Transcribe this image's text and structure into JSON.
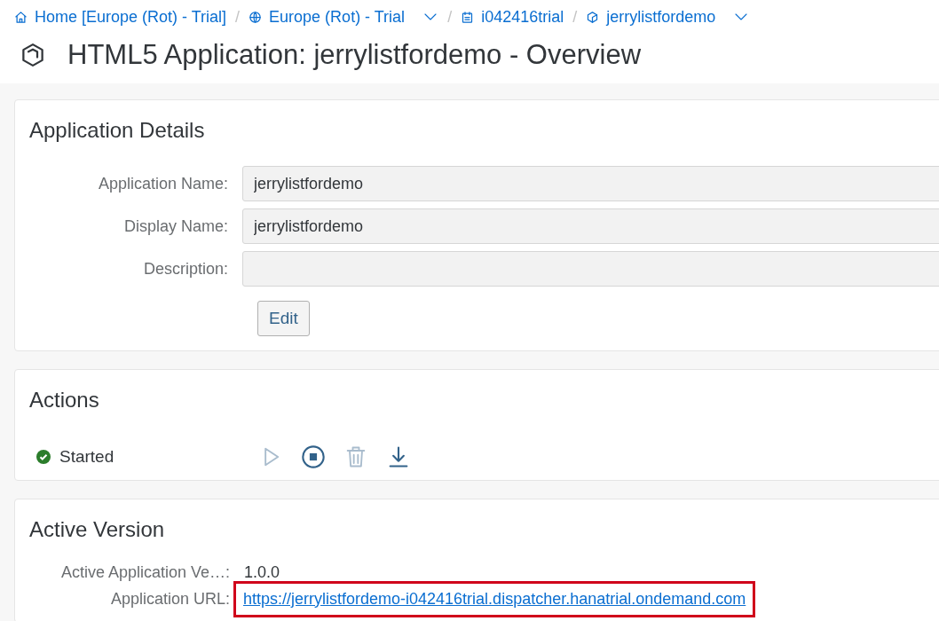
{
  "breadcrumb": [
    {
      "kind": "home",
      "label": "Home [Europe (Rot) - Trial]",
      "dropdown": false
    },
    {
      "kind": "globe",
      "label": "Europe (Rot) - Trial",
      "dropdown": true,
      "separator": "/"
    },
    {
      "kind": "account",
      "label": "i042416trial",
      "dropdown": false,
      "separator": "/"
    },
    {
      "kind": "app",
      "label": "jerrylistfordemo",
      "dropdown": true,
      "separator": "/"
    }
  ],
  "title": "HTML5 Application: jerrylistfordemo - Overview",
  "details": {
    "title": "Application Details",
    "fields": [
      {
        "label": "Application Name:",
        "value": "jerrylistfordemo"
      },
      {
        "label": "Display Name:",
        "value": "jerrylistfordemo"
      },
      {
        "label": "Description:"
      }
    ],
    "edit_button": "Edit"
  },
  "actions": {
    "title": "Actions",
    "status": {
      "label": "Started",
      "kind": "success"
    },
    "buttons": [
      {
        "kind": "start",
        "disabled": true
      },
      {
        "kind": "stop",
        "disabled": false
      },
      {
        "kind": "delete",
        "disabled": true
      },
      {
        "kind": "download",
        "disabled": false
      }
    ]
  },
  "active_version": {
    "title": "Active Version",
    "rows": [
      {
        "label": "Active Application Ve…:",
        "value": "1.0.0",
        "kind": "text",
        "highlighted": false
      },
      {
        "label": "Application URL:",
        "value": "https://jerrylistfordemo-i042416trial.dispatcher.hanatrial.ondemand.com",
        "kind": "link",
        "highlighted": true
      }
    ]
  }
}
